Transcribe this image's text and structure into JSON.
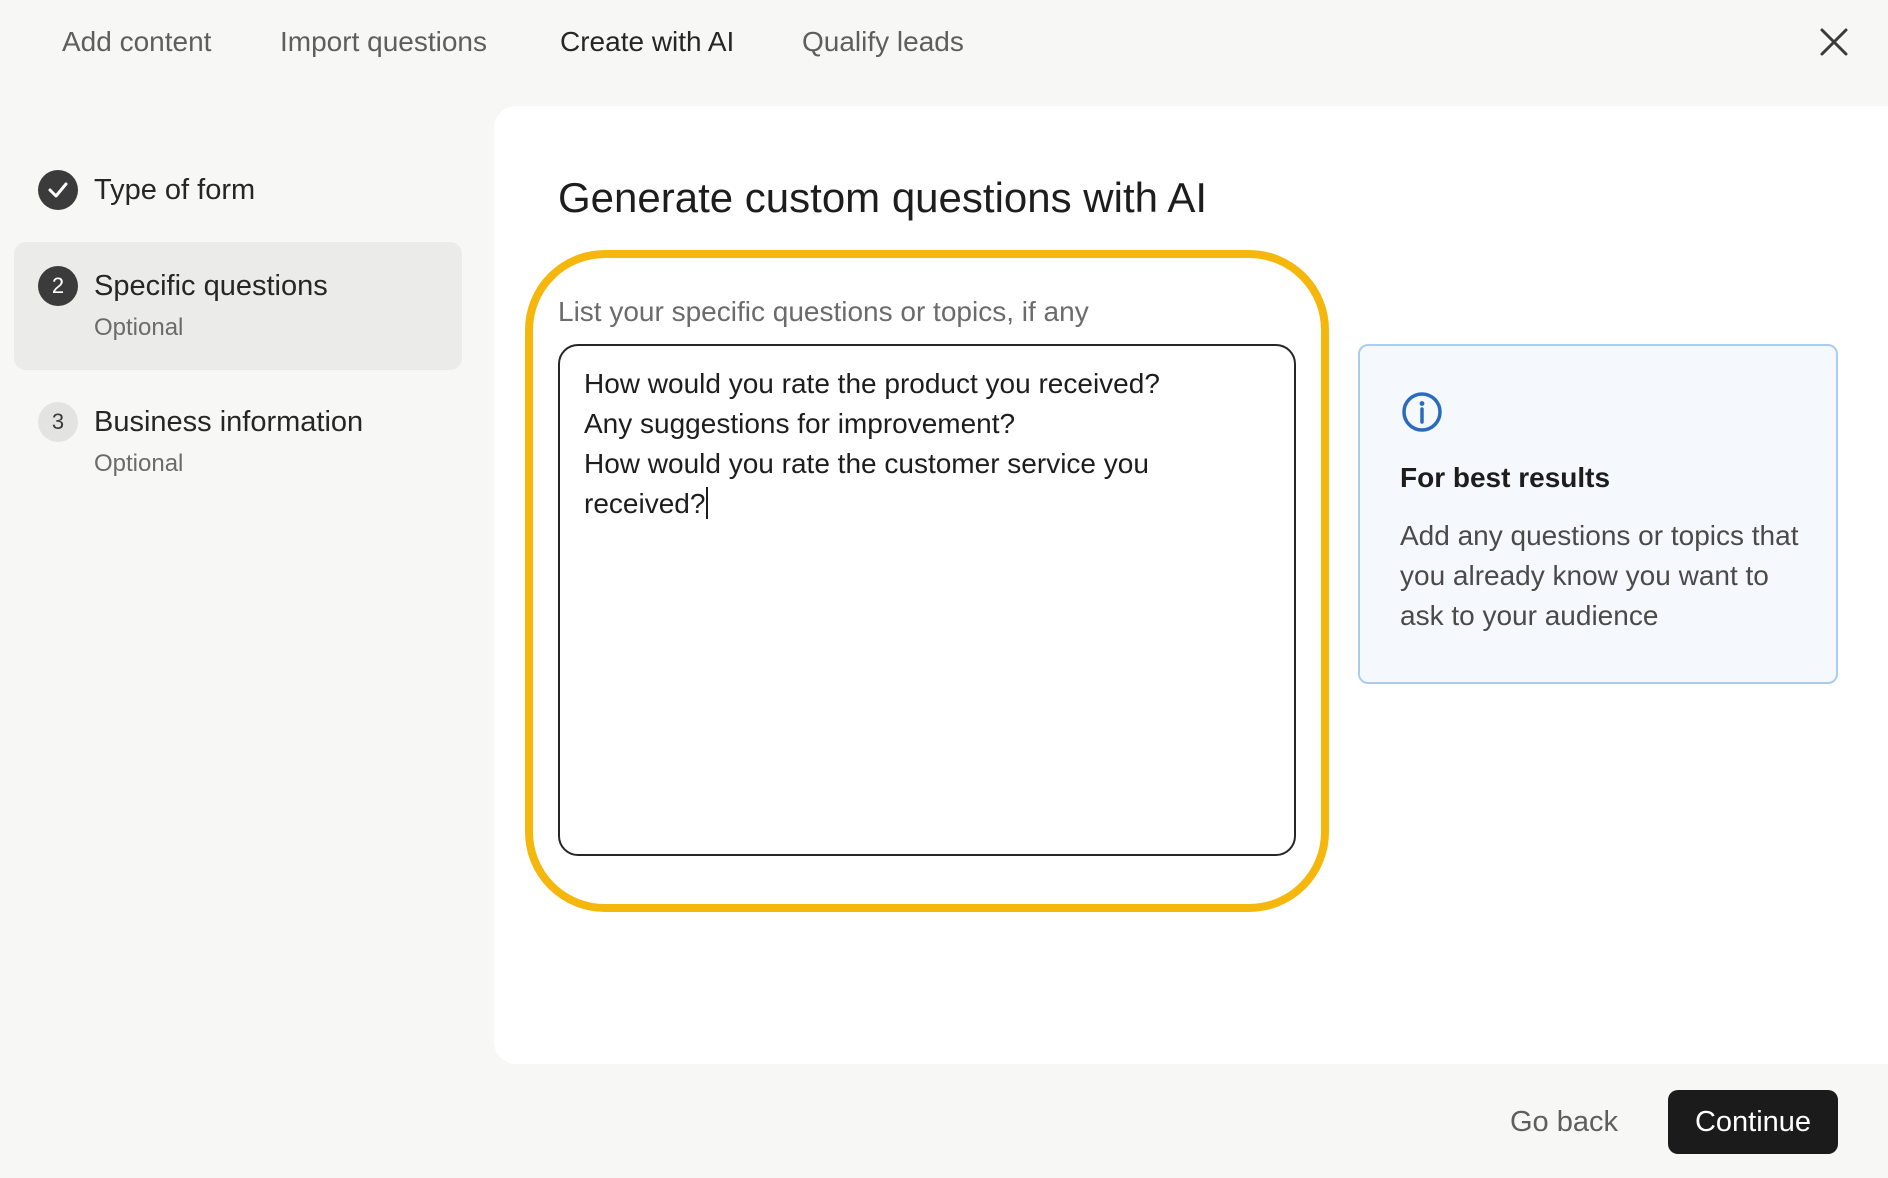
{
  "tabs": [
    {
      "label": "Add content",
      "active": false
    },
    {
      "label": "Import questions",
      "active": false
    },
    {
      "label": "Create with AI",
      "active": true
    },
    {
      "label": "Qualify leads",
      "active": false
    }
  ],
  "steps": [
    {
      "number": "",
      "title": "Type of form",
      "subtitle": "",
      "state": "done"
    },
    {
      "number": "2",
      "title": "Specific questions",
      "subtitle": "Optional",
      "state": "current"
    },
    {
      "number": "3",
      "title": "Business information",
      "subtitle": "Optional",
      "state": "future"
    }
  ],
  "main": {
    "title": "Generate custom questions with AI",
    "field_label": "List your specific questions or topics, if any",
    "textarea_lines": [
      "How would you rate the product you received?",
      "Any suggestions for improvement?",
      "How would you rate the customer service you",
      "received?"
    ]
  },
  "info": {
    "title": "For best results",
    "body": "Add any questions or topics that you already know you want to ask to your audience"
  },
  "footer": {
    "back_label": "Go back",
    "continue_label": "Continue"
  },
  "colors": {
    "highlight": "#f6b70d",
    "info_border": "#aacdef",
    "info_icon": "#2a6bbf",
    "primary_button": "#1b1b1b"
  }
}
